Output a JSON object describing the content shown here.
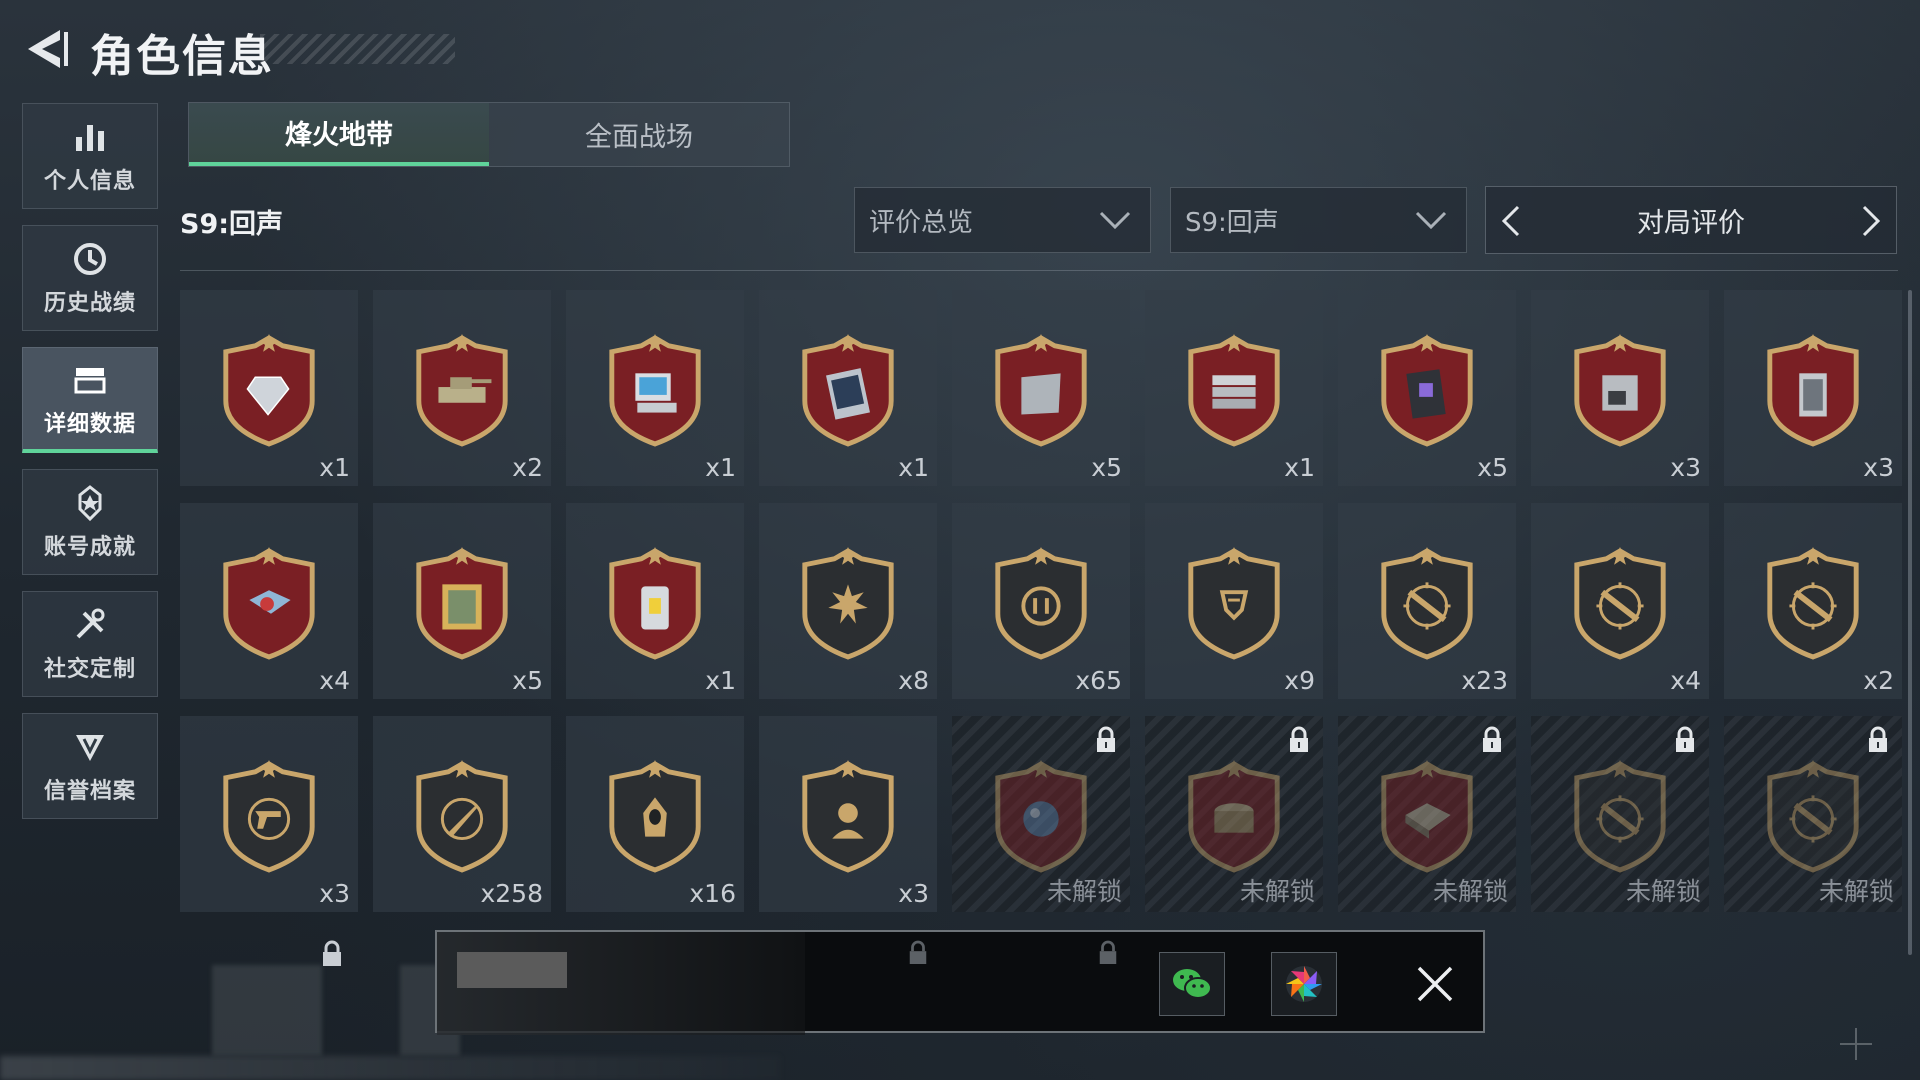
{
  "header": {
    "title": "角色信息"
  },
  "sidebar": {
    "items": [
      {
        "label": "个人信息",
        "icon": "bar-chart-icon",
        "active": false
      },
      {
        "label": "历史战绩",
        "icon": "history-clock-icon",
        "active": false
      },
      {
        "label": "详细数据",
        "icon": "data-folder-icon",
        "active": true
      },
      {
        "label": "账号成就",
        "icon": "achievement-icon",
        "active": false
      },
      {
        "label": "社交定制",
        "icon": "tools-icon",
        "active": false
      },
      {
        "label": "信誉档案",
        "icon": "credit-shield-icon",
        "active": false
      }
    ]
  },
  "tabs": [
    {
      "label": "烽火地带",
      "active": true
    },
    {
      "label": "全面战场",
      "active": false
    }
  ],
  "season_label": "S9:回声",
  "filters": {
    "overview": "评价总览",
    "season": "S9:回声",
    "pager_label": "对局评价"
  },
  "badges": [
    {
      "item": "diamond",
      "frame": "red",
      "count": "x1",
      "locked": false
    },
    {
      "item": "tank",
      "frame": "red",
      "count": "x2",
      "locked": false
    },
    {
      "item": "computer",
      "frame": "red",
      "count": "x1",
      "locked": false
    },
    {
      "item": "tablet",
      "frame": "red",
      "count": "x1",
      "locked": false
    },
    {
      "item": "metal-plate",
      "frame": "red",
      "count": "x5",
      "locked": false
    },
    {
      "item": "servers",
      "frame": "red",
      "count": "x1",
      "locked": false
    },
    {
      "item": "circuit-board",
      "frame": "red",
      "count": "x5",
      "locked": false
    },
    {
      "item": "coffee-machine",
      "frame": "red",
      "count": "x3",
      "locked": false
    },
    {
      "item": "reactor-core",
      "frame": "red",
      "count": "x3",
      "locked": false
    },
    {
      "item": "drone",
      "frame": "red",
      "count": "x4",
      "locked": false
    },
    {
      "item": "painting",
      "frame": "red",
      "count": "x5",
      "locked": false
    },
    {
      "item": "battery-cell",
      "frame": "red",
      "count": "x1",
      "locked": false
    },
    {
      "item": "skull-burst",
      "frame": "dark",
      "count": "x8",
      "locked": false
    },
    {
      "item": "emblem-wreath",
      "frame": "dark",
      "count": "x65",
      "locked": false
    },
    {
      "item": "shield-wreath",
      "frame": "dark",
      "count": "x9",
      "locked": false
    },
    {
      "item": "rifle-crosshair",
      "frame": "dark",
      "count": "x23",
      "locked": false
    },
    {
      "item": "rifle-crosshair",
      "frame": "dark",
      "count": "x4",
      "locked": false
    },
    {
      "item": "rifle-crosshair",
      "frame": "dark",
      "count": "x2",
      "locked": false
    },
    {
      "item": "pistol-crosshair",
      "frame": "dark",
      "count": "x3",
      "locked": false
    },
    {
      "item": "knife-crosshair",
      "frame": "dark",
      "count": "x258",
      "locked": false
    },
    {
      "item": "hooded-figure",
      "frame": "dark",
      "count": "x16",
      "locked": false
    },
    {
      "item": "operator-portrait",
      "frame": "dark",
      "count": "x3",
      "locked": false
    },
    {
      "item": "orb",
      "frame": "red",
      "count": "未解锁",
      "locked": true
    },
    {
      "item": "jewel-box",
      "frame": "red",
      "count": "未解锁",
      "locked": true
    },
    {
      "item": "chess-board",
      "frame": "red",
      "count": "未解锁",
      "locked": true
    },
    {
      "item": "rifle-crosshair",
      "frame": "dark",
      "count": "未解锁",
      "locked": true
    },
    {
      "item": "rifle-crosshair",
      "frame": "dark",
      "count": "未解锁",
      "locked": true
    }
  ],
  "share": {
    "wechat_icon": "wechat-icon",
    "moments_icon": "moments-aperture-icon",
    "close_icon": "close-icon"
  },
  "colors": {
    "accent_green": "#5fd39a",
    "frame_red": "#7a1f24",
    "frame_gold": "#c9a66b",
    "frame_dark": "#2b2e31"
  }
}
